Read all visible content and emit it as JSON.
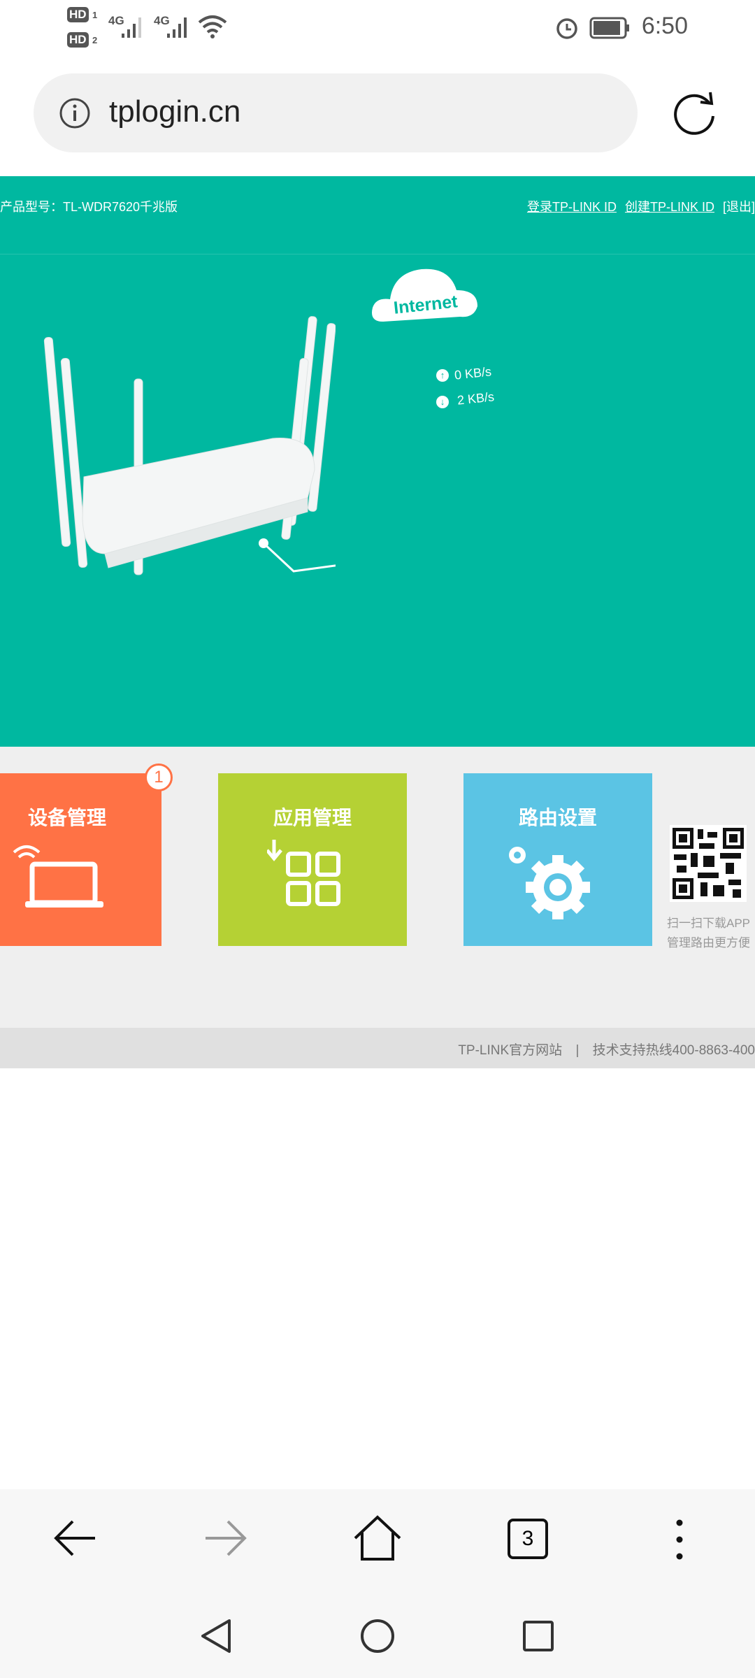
{
  "status_bar": {
    "sim1": "HD",
    "sim1_num": "1",
    "sim2": "HD",
    "sim2_num": "2",
    "net1": "4G",
    "net2": "4G",
    "time": "6:50",
    "icons": [
      "signal-icon",
      "wifi-icon",
      "alarm-icon",
      "battery-icon"
    ]
  },
  "browser": {
    "url": "tplogin.cn",
    "tab_count": "3"
  },
  "header": {
    "model": "产品型号：TL-WDR7620千兆版",
    "login": "登录TP-LINK ID",
    "create": "创建TP-LINK ID",
    "logout": "[退出]"
  },
  "network": {
    "cloud_label": "Internet",
    "upload": "0 KB/s",
    "download": "2 KB/s"
  },
  "tiles": [
    {
      "label": "设备管理",
      "badge": "1",
      "color": "#ff7245"
    },
    {
      "label": "应用管理",
      "color": "#b5d134"
    },
    {
      "label": "路由设置",
      "color": "#5bc4e4"
    }
  ],
  "qr": {
    "line1": "扫一扫下载APP",
    "line2": "管理路由更方便"
  },
  "footer": {
    "site": "TP-LINK官方网站",
    "sep": "|",
    "hotline": "技术支持热线400-8863-400"
  }
}
